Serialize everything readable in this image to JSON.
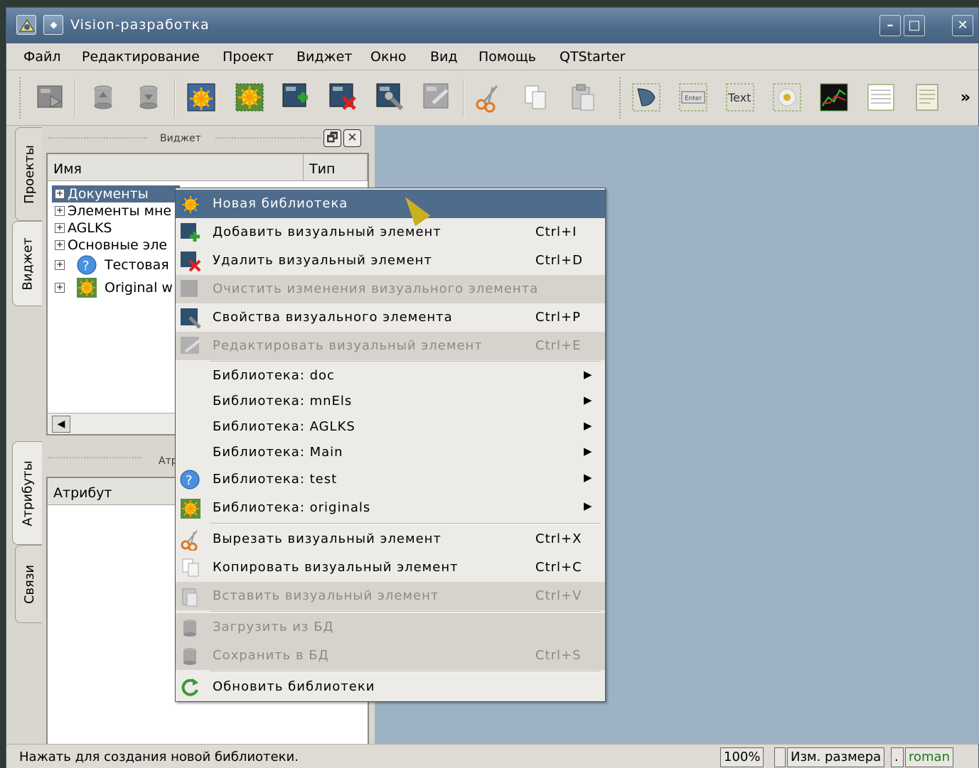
{
  "window": {
    "title": "Vision-разработка",
    "minimize": "–",
    "maximize": "□",
    "close": "✕"
  },
  "menubar": [
    "Файл",
    "Редактирование",
    "Проект",
    "Виджет",
    "Окно",
    "Вид",
    "Помощь",
    "QTStarter"
  ],
  "toolbar": {
    "more": "»",
    "enter_label": "Enter",
    "text_label": "Text"
  },
  "side_tabs": {
    "projects": "Проекты",
    "widget": "Виджет",
    "attributes": "Атрибуты",
    "links": "Связи"
  },
  "widget_dock": {
    "title": "Виджет",
    "float": "🗗",
    "close": "✕",
    "col_name": "Имя",
    "col_type": "Тип",
    "items": [
      "Документы",
      "Элементы мне",
      "AGLKS",
      "Основные эле",
      "Тестовая",
      "Original w"
    ],
    "scroll_left": "◀"
  },
  "attr_dock": {
    "title": "Атр",
    "col_attr": "Атрибут"
  },
  "context_menu": {
    "items": [
      {
        "label": "Новая библиотека",
        "shortcut": ""
      },
      {
        "label": "Добавить визуальный элемент",
        "shortcut": "Ctrl+I"
      },
      {
        "label": "Удалить визуальный элемент",
        "shortcut": "Ctrl+D"
      },
      {
        "label": "Очистить изменения визуального элемента",
        "shortcut": ""
      },
      {
        "label": "Свойства визуального элемента",
        "shortcut": "Ctrl+P"
      },
      {
        "label": "Редактировать визуальный элемент",
        "shortcut": "Ctrl+E"
      },
      {
        "label": "Библиотека: doc",
        "shortcut": ""
      },
      {
        "label": "Библиотека: mnEls",
        "shortcut": ""
      },
      {
        "label": "Библиотека: AGLKS",
        "shortcut": ""
      },
      {
        "label": "Библиотека: Main",
        "shortcut": ""
      },
      {
        "label": "Библиотека: test",
        "shortcut": ""
      },
      {
        "label": "Библиотека: originals",
        "shortcut": ""
      },
      {
        "label": "Вырезать визуальный элемент",
        "shortcut": "Ctrl+X"
      },
      {
        "label": "Копировать визуальный элемент",
        "shortcut": "Ctrl+C"
      },
      {
        "label": "Вставить визуальный элемент",
        "shortcut": "Ctrl+V"
      },
      {
        "label": "Загрузить из БД",
        "shortcut": ""
      },
      {
        "label": "Сохранить в БД",
        "shortcut": "Ctrl+S"
      },
      {
        "label": "Обновить библиотеки",
        "shortcut": ""
      }
    ],
    "submenu_arrow": "▶"
  },
  "statusbar": {
    "hint": "Нажать для создания новой библиотеки.",
    "zoom": "100%",
    "resize": "Изм. размера",
    "dot": ".",
    "user": "roman"
  },
  "colors": {
    "titlebar": "#4f6c8c",
    "workspace": "#9db2c5",
    "highlight": "#4f6c8c",
    "menu_bg": "#ecebe7"
  }
}
